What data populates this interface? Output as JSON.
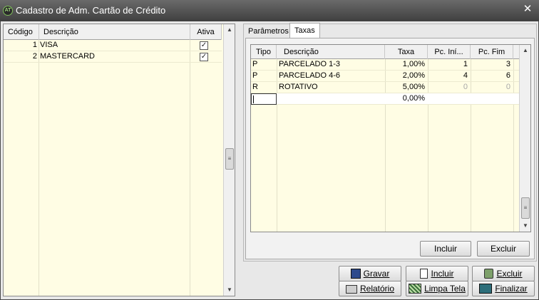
{
  "window": {
    "title": "Cadastro de Adm. Cartão de Crédito",
    "close_glyph": "✕"
  },
  "left_grid": {
    "columns": [
      "Código",
      "Descrição",
      "Ativa"
    ],
    "rows": [
      {
        "codigo": "1",
        "descricao": "VISA",
        "ativa": true
      },
      {
        "codigo": "2",
        "descricao": "MASTERCARD",
        "ativa": true
      }
    ],
    "check_glyph": "✓"
  },
  "tabs": [
    "Parâmetros",
    "Taxas"
  ],
  "active_tab": "Taxas",
  "taxas_grid": {
    "columns": [
      "Tipo",
      "Descrição",
      "Taxa",
      "Pc. Iní...",
      "Pc. Fim"
    ],
    "rows": [
      {
        "tipo": "P",
        "descricao": "PARCELADO 1-3",
        "taxa": "1,00%",
        "pc_ini": "1",
        "pc_fim": "3"
      },
      {
        "tipo": "P",
        "descricao": "PARCELADO 4-6",
        "taxa": "2,00%",
        "pc_ini": "4",
        "pc_fim": "6"
      },
      {
        "tipo": "R",
        "descricao": "ROTATIVO",
        "taxa": "5,00%",
        "pc_ini": "0",
        "pc_fim": "0"
      }
    ],
    "new_row": {
      "tipo": "",
      "descricao": "",
      "taxa": "0,00%",
      "pc_ini": "",
      "pc_fim": ""
    }
  },
  "grid_buttons": {
    "incluir": "Incluir",
    "excluir": "Excluir"
  },
  "toolbar": {
    "gravar": "Gravar",
    "incluir": "Incluir",
    "excluir": "Excluir",
    "relatorio": "Relatório",
    "limpa_tela": "Limpa Tela",
    "finalizar": "Finalizar"
  },
  "scrollbar_glyphs": {
    "up": "▲",
    "down": "▼",
    "grip": "≡"
  },
  "icons": {
    "app": "app-logo-icon",
    "gravar": "floppy-disk-icon",
    "incluir": "new-document-icon",
    "excluir": "trash-bin-icon",
    "relatorio": "printer-icon",
    "limpa_tela": "clear-screen-icon",
    "finalizar": "exit-icon"
  }
}
